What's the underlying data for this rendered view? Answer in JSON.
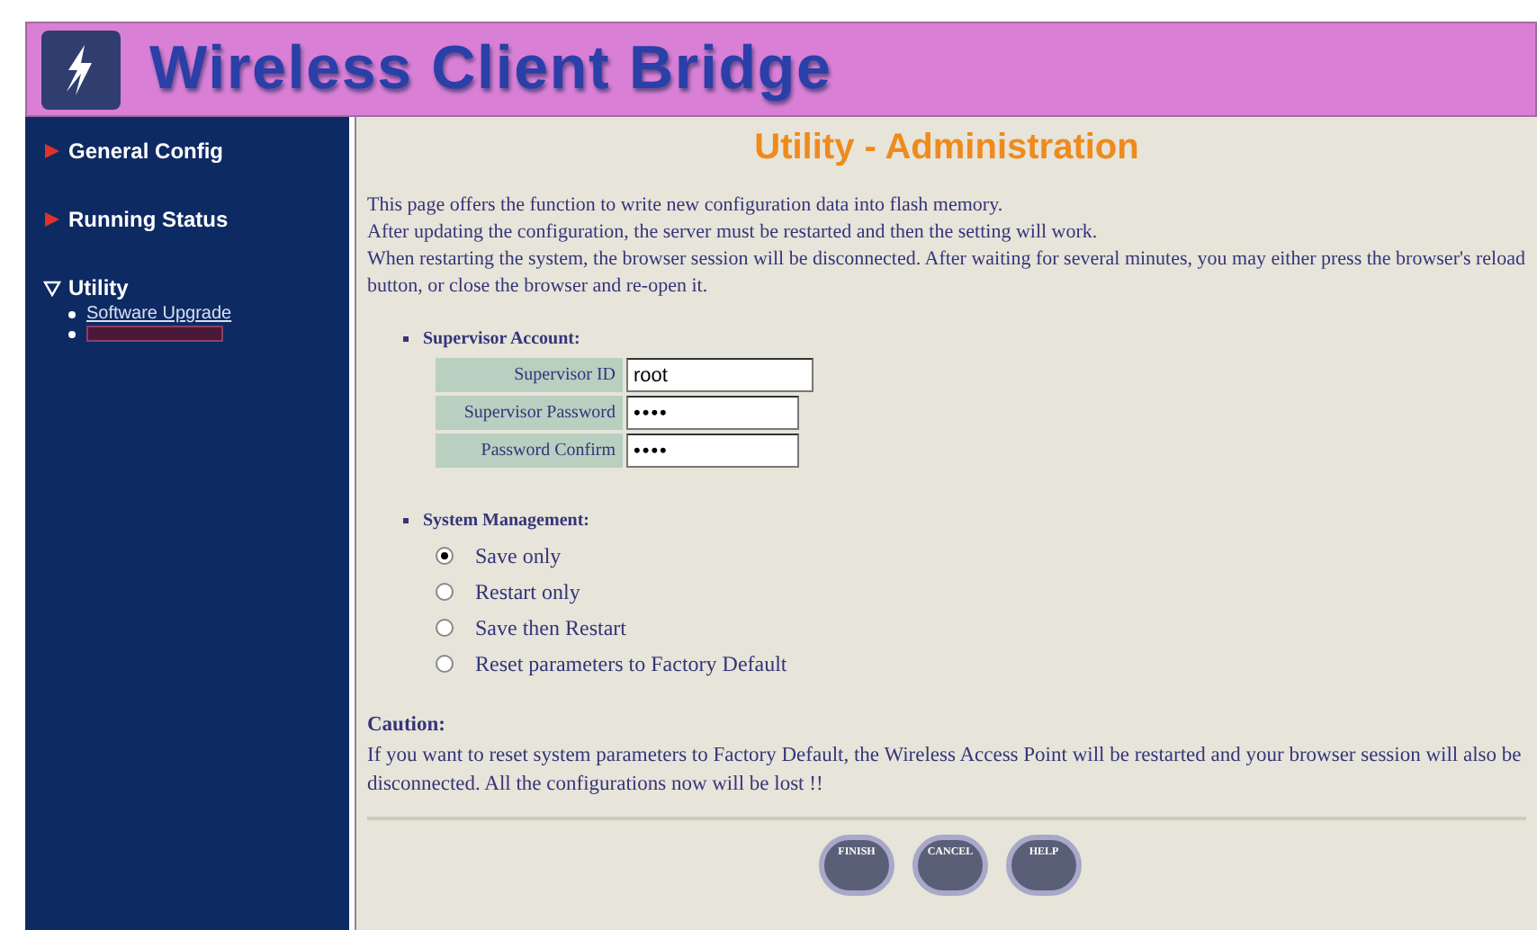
{
  "header": {
    "title": "Wireless Client Bridge"
  },
  "sidebar": {
    "items": [
      {
        "label": "General Config",
        "expanded": false
      },
      {
        "label": "Running Status",
        "expanded": false
      },
      {
        "label": "Utility",
        "expanded": true,
        "children": [
          {
            "label": "Software Upgrade",
            "selected": false
          },
          {
            "selected": true
          }
        ]
      }
    ]
  },
  "page": {
    "title": "Utility - Administration",
    "intro": [
      "This page offers the function to write new configuration data into flash memory.",
      "After updating the configuration, the server must be restarted and then the setting will work.",
      "When restarting the system, the browser session will be disconnected. After waiting for several minutes, you may either press the browser's reload button, or close the browser and re-open it."
    ],
    "account": {
      "heading": "Supervisor Account:",
      "fields": [
        {
          "label": "Supervisor ID",
          "kind": "text",
          "value": "root"
        },
        {
          "label": "Supervisor Password",
          "kind": "password",
          "value": "••••"
        },
        {
          "label": "Password Confirm",
          "kind": "password",
          "value": "••••"
        }
      ]
    },
    "management": {
      "heading": "System Management:",
      "options": [
        {
          "label": "Save only",
          "selected": true
        },
        {
          "label": "Restart only",
          "selected": false
        },
        {
          "label": "Save then Restart",
          "selected": false
        },
        {
          "label": "Reset parameters to Factory Default",
          "selected": false
        }
      ]
    },
    "caution": {
      "heading": "Caution:",
      "text": "If you want to reset system parameters to Factory Default, the Wireless Access Point will be restarted and your browser session will also be disconnected. All the configurations now will be lost !!"
    },
    "buttons": [
      "FINISH",
      "CANCEL",
      "HELP"
    ]
  }
}
